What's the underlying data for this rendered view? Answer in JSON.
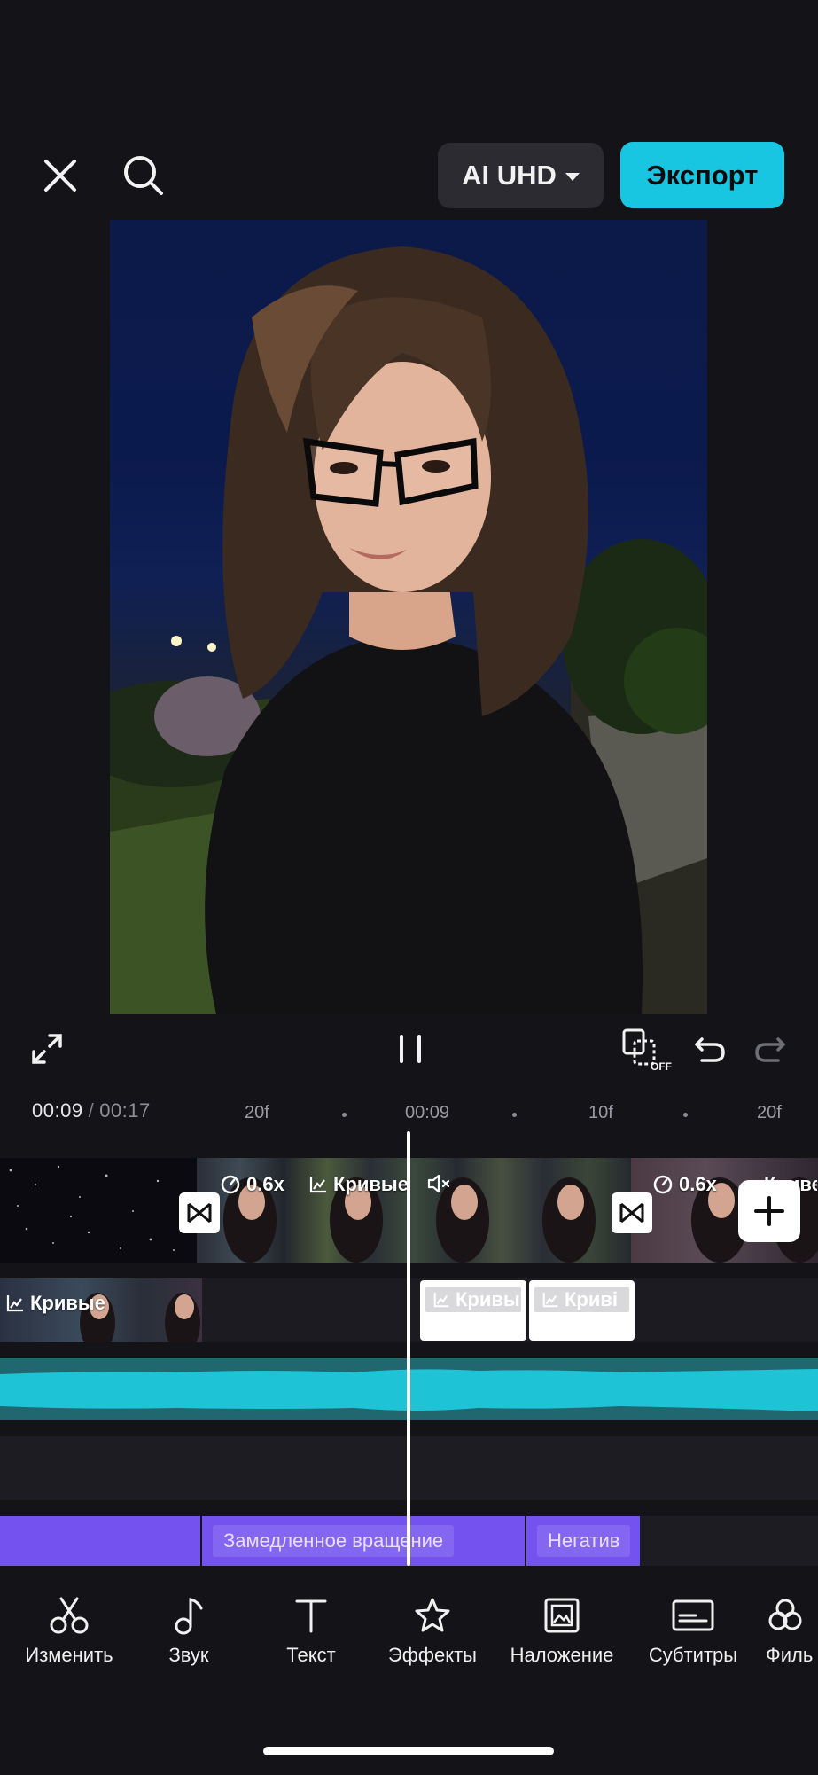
{
  "topbar": {
    "close_icon": "close-icon",
    "search_icon": "search-icon",
    "resolution_label": "AI UHD",
    "export_label": "Экспорт"
  },
  "controls": {
    "fullscreen_icon": "fullscreen-icon",
    "pause_icon": "pause-icon",
    "keyframe_off_label": "OFF",
    "undo_icon": "undo-icon",
    "redo_icon": "redo-icon"
  },
  "timeline": {
    "current_time": "00:09",
    "separator": "/",
    "total_time": "00:17",
    "ruler": [
      "20f",
      "00:09",
      "10f",
      "20f"
    ]
  },
  "main_track": {
    "speed_label_1": "0.6x",
    "curves_label_1": "Кривые",
    "speed_label_2": "0.6x",
    "curves_label_2": "Криве"
  },
  "overlay_track": {
    "curves_label": "Кривые",
    "effect_card_1": "Кривы",
    "effect_card_2": "Криві"
  },
  "effects_track": {
    "label_1": "Замедленное вращение",
    "label_2": "Негатив"
  },
  "toolbar": {
    "items": [
      {
        "label": "Изменить",
        "icon": "scissors-icon"
      },
      {
        "label": "Звук",
        "icon": "music-note-icon"
      },
      {
        "label": "Текст",
        "icon": "text-icon"
      },
      {
        "label": "Эффекты",
        "icon": "effects-star-icon"
      },
      {
        "label": "Наложение",
        "icon": "overlay-icon"
      },
      {
        "label": "Субтитры",
        "icon": "subtitles-icon"
      },
      {
        "label": "Филь",
        "icon": "filters-icon"
      }
    ]
  },
  "colors": {
    "accent": "#19c6e2",
    "audio_wave": "#1ec3d6",
    "effects_bar": "#7352f0",
    "background": "#141318"
  }
}
